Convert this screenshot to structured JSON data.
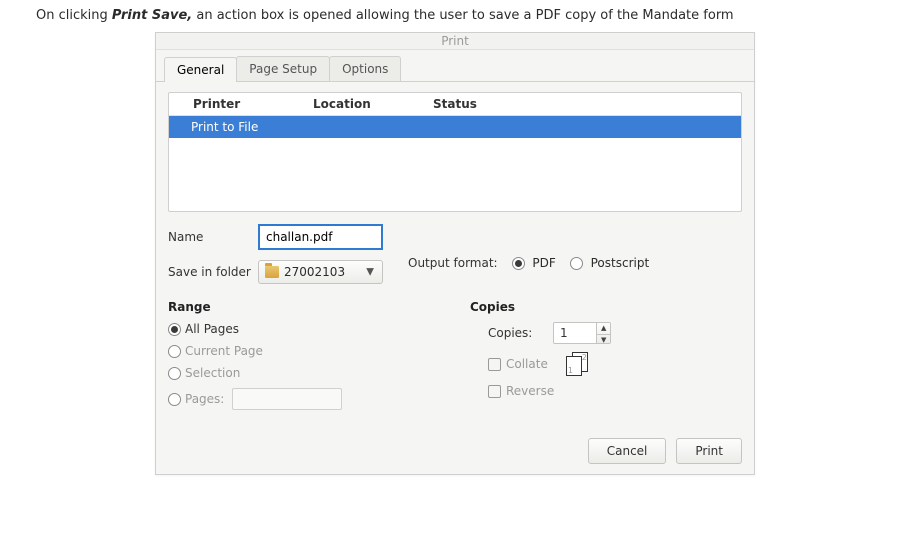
{
  "caption": {
    "prefix": "On clicking ",
    "bold": "Print Save,",
    "suffix": " an action box is opened allowing the user to save a PDF copy of the Mandate form"
  },
  "dialog": {
    "title": "Print",
    "tabs": [
      "General",
      "Page Setup",
      "Options"
    ],
    "active_tab": 0,
    "printer_table": {
      "headers": {
        "printer": "Printer",
        "location": "Location",
        "status": "Status"
      },
      "rows": [
        {
          "name": "Print to File"
        }
      ]
    },
    "name_label": "Name",
    "name_value": "challan.pdf",
    "folder_label": "Save in folder",
    "folder_value": "27002103",
    "output_label": "Output format:",
    "output_options": [
      {
        "label": "PDF",
        "checked": true
      },
      {
        "label": "Postscript",
        "checked": false
      }
    ],
    "range": {
      "title": "Range",
      "options": [
        {
          "label": "All Pages",
          "checked": true,
          "disabled": false
        },
        {
          "label": "Current Page",
          "checked": false,
          "disabled": true
        },
        {
          "label": "Selection",
          "checked": false,
          "disabled": true
        },
        {
          "label": "Pages:",
          "checked": false,
          "disabled": true,
          "has_input": true
        }
      ]
    },
    "copies": {
      "title": "Copies",
      "copies_label": "Copies:",
      "copies_value": "1",
      "collate_label": "Collate",
      "reverse_label": "Reverse"
    },
    "buttons": {
      "cancel": "Cancel",
      "print": "Print"
    }
  }
}
